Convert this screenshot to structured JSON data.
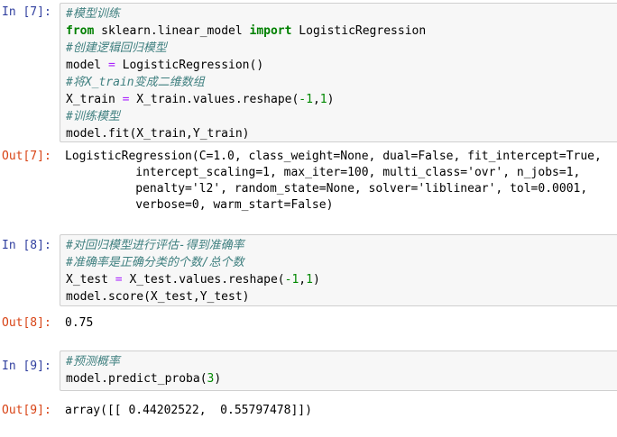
{
  "cells": [
    {
      "in_prompt": "In [7]:",
      "lines": [
        [
          {
            "t": "#模型训练",
            "c": "cm"
          }
        ],
        [
          {
            "t": "from",
            "c": "kw"
          },
          {
            "t": " sklearn.linear_model ",
            "c": ""
          },
          {
            "t": "import",
            "c": "kw"
          },
          {
            "t": " LogisticRegression",
            "c": ""
          }
        ],
        [
          {
            "t": "#创建逻辑回归模型",
            "c": "cm"
          }
        ],
        [
          {
            "t": "model ",
            "c": ""
          },
          {
            "t": "=",
            "c": "op"
          },
          {
            "t": " LogisticRegression()",
            "c": ""
          }
        ],
        [
          {
            "t": "#将X_train变成二维数组",
            "c": "cm"
          }
        ],
        [
          {
            "t": "X_train ",
            "c": ""
          },
          {
            "t": "=",
            "c": "op"
          },
          {
            "t": " X_train.values.reshape(",
            "c": ""
          },
          {
            "t": "-1",
            "c": "num"
          },
          {
            "t": ",",
            "c": ""
          },
          {
            "t": "1",
            "c": "num"
          },
          {
            "t": ")",
            "c": ""
          }
        ],
        [
          {
            "t": "#训练模型",
            "c": "cm"
          }
        ],
        [
          {
            "t": "model.fit(X_train,Y_train)",
            "c": ""
          }
        ]
      ],
      "out_prompt": "Out[7]:",
      "output": [
        "LogisticRegression(C=1.0, class_weight=None, dual=False, fit_intercept=True,",
        "          intercept_scaling=1, max_iter=100, multi_class='ovr', n_jobs=1,",
        "          penalty='l2', random_state=None, solver='liblinear', tol=0.0001,",
        "          verbose=0, warm_start=False)"
      ]
    },
    {
      "in_prompt": "In [8]:",
      "lines": [
        [
          {
            "t": "#对回归模型进行评估-得到准确率",
            "c": "cm"
          }
        ],
        [
          {
            "t": "#准确率是正确分类的个数/总个数",
            "c": "cm"
          }
        ],
        [
          {
            "t": "X_test ",
            "c": ""
          },
          {
            "t": "=",
            "c": "op"
          },
          {
            "t": " X_test.values.reshape(",
            "c": ""
          },
          {
            "t": "-1",
            "c": "num"
          },
          {
            "t": ",",
            "c": ""
          },
          {
            "t": "1",
            "c": "num"
          },
          {
            "t": ")",
            "c": ""
          }
        ],
        [
          {
            "t": "model.score(X_test,Y_test)",
            "c": ""
          }
        ]
      ],
      "out_prompt": "Out[8]:",
      "output": [
        "0.75"
      ]
    },
    {
      "in_prompt": "In [9]:",
      "lines": [
        [
          {
            "t": "#预测概率",
            "c": "cm"
          }
        ],
        [
          {
            "t": "model.predict_proba(",
            "c": ""
          },
          {
            "t": "3",
            "c": "num"
          },
          {
            "t": ")",
            "c": ""
          }
        ]
      ],
      "out_prompt": "Out[9]:",
      "output": [
        "array([[ 0.44202522,  0.55797478]])"
      ]
    }
  ]
}
